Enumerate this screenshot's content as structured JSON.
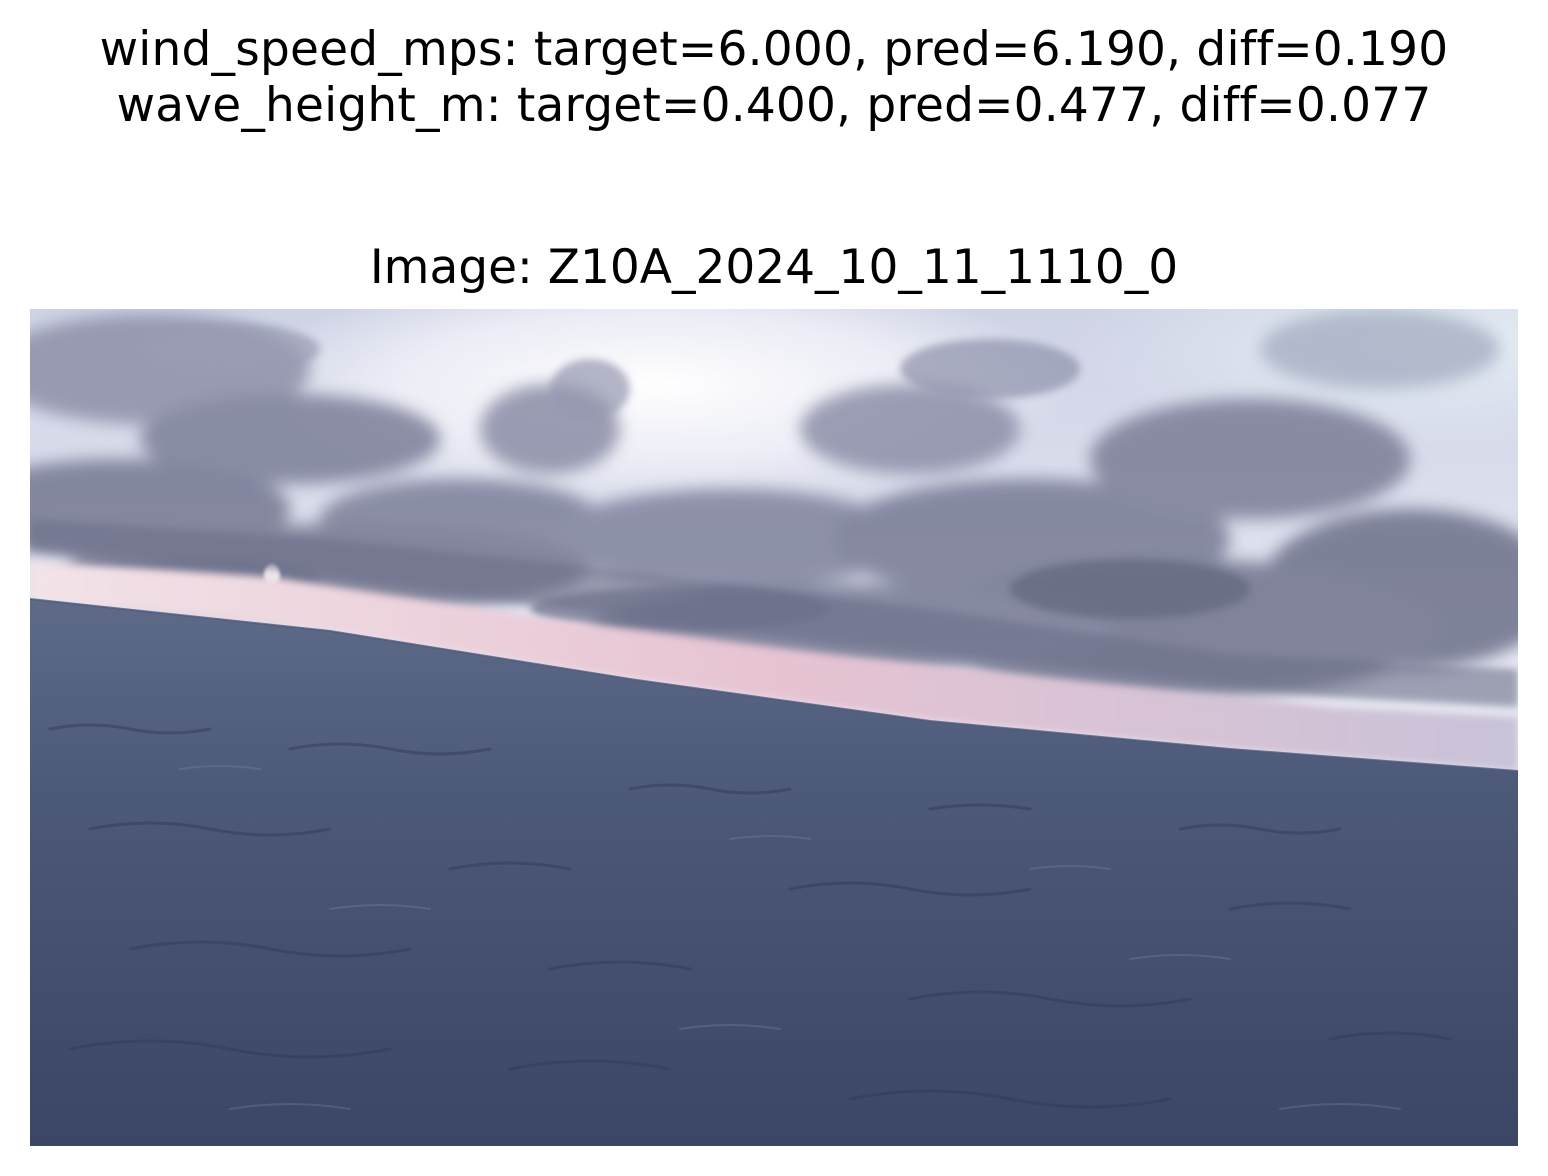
{
  "figure": {
    "metrics": [
      {
        "name": "wind_speed_mps",
        "target": "6.000",
        "pred": "6.190",
        "diff": "0.190",
        "line": "wind_speed_mps: target=6.000, pred=6.190, diff=0.190"
      },
      {
        "name": "wave_height_m",
        "target": "0.400",
        "pred": "0.477",
        "diff": "0.077",
        "line": "wave_height_m: target=0.400, pred=0.477, diff=0.077"
      }
    ],
    "image_title": "Image: Z10A_2024_10_11_1110_0"
  },
  "colors": {
    "text": "#000000",
    "background": "#ffffff",
    "sky_light": "#f4f4fb",
    "cloud_dark": "#6e7188",
    "horizon_pink": "#e7c9d6",
    "sea": "#4a5676"
  }
}
